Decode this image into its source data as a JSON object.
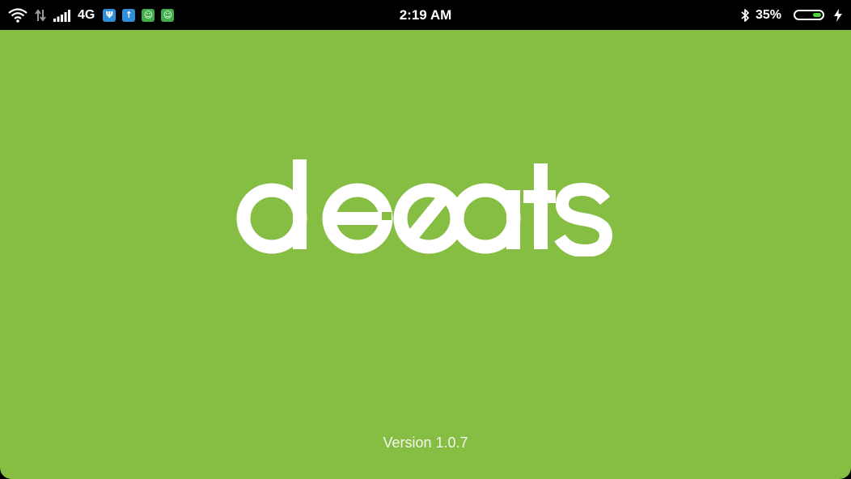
{
  "status_bar": {
    "network_type": "4G",
    "time": "2:19 AM",
    "battery_percent": "35%",
    "battery_level": 0.35,
    "icons": {
      "left": [
        "wifi-icon",
        "data-arrows-icon",
        "signal-icon"
      ],
      "notifications": [
        {
          "name": "usb-notification-icon",
          "glyph": "Ψ",
          "color": "#2f8fd8"
        },
        {
          "name": "upload-notification-icon",
          "glyph": "↑",
          "color": "#2f8fd8"
        },
        {
          "name": "app-notification-icon",
          "glyph": "☺",
          "color": "#3fae49"
        },
        {
          "name": "app-notification-icon",
          "glyph": "☺",
          "color": "#3fae49"
        }
      ],
      "right": [
        "bluetooth-icon",
        "battery-icon",
        "charging-icon"
      ]
    },
    "battery_fill_color": "#4cd43a"
  },
  "splash": {
    "background_color": "#86bd43",
    "logo_text": "deeats",
    "version": "Version 1.0.7"
  }
}
